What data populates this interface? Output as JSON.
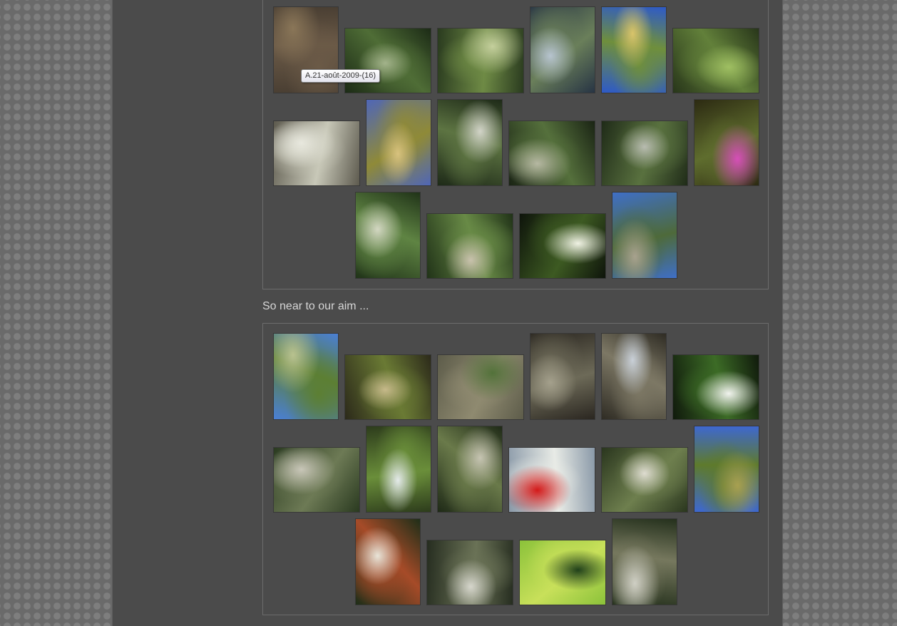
{
  "tooltip": "A.21-août-2009-(16)",
  "caption": "So near to our aim ...",
  "galleries": [
    {
      "id": "gallery-1",
      "photos": [
        {
          "kind": "forest-floor",
          "colors": [
            "#4a3f33",
            "#6b5a47",
            "#8a7658"
          ]
        },
        {
          "kind": "forest-path",
          "colors": [
            "#1c2b16",
            "#4f6d36",
            "#a3b38b"
          ]
        },
        {
          "kind": "hiker-forest",
          "colors": [
            "#2a3b1f",
            "#6e8a45",
            "#c4cf9c"
          ]
        },
        {
          "kind": "stream-rock",
          "colors": [
            "#273444",
            "#6a7f5a",
            "#b7c4cf"
          ]
        },
        {
          "kind": "mountain-sky",
          "colors": [
            "#2e5ac8",
            "#6f8f3c",
            "#d9c46a"
          ]
        },
        {
          "kind": "grass",
          "colors": [
            "#28361a",
            "#62803a",
            "#9fbf62"
          ]
        },
        {
          "kind": "map-sign",
          "colors": [
            "#5d5a4e",
            "#c8c8b8",
            "#e8e8de"
          ]
        },
        {
          "kind": "valley-path",
          "colors": [
            "#4f66b7",
            "#8f8a38",
            "#d8c27e"
          ]
        },
        {
          "kind": "shadow-path",
          "colors": [
            "#1e2a18",
            "#5d7442",
            "#d2d4c8"
          ]
        },
        {
          "kind": "forest-trail",
          "colors": [
            "#1a2414",
            "#55703c",
            "#b6b8a2"
          ]
        },
        {
          "kind": "group-hikers",
          "colors": [
            "#1f2b18",
            "#59713f",
            "#b8bcb0"
          ]
        },
        {
          "kind": "pink-thistle",
          "colors": [
            "#2c2a12",
            "#5f6d2e",
            "#d64fb8"
          ]
        },
        {
          "kind": "resting-hiker",
          "colors": [
            "#203318",
            "#5f8443",
            "#d3d7c2"
          ]
        },
        {
          "kind": "hiker-bench",
          "colors": [
            "#213318",
            "#688a46",
            "#c9c2ad"
          ]
        },
        {
          "kind": "white-flower",
          "colors": [
            "#0e140b",
            "#3d5a22",
            "#f0f2e4"
          ]
        },
        {
          "kind": "mountain-valley",
          "colors": [
            "#3f6fc7",
            "#4e6a3a",
            "#a8a28e"
          ]
        }
      ]
    },
    {
      "id": "gallery-2",
      "photos": [
        {
          "kind": "hiker-slope",
          "colors": [
            "#4a7fd6",
            "#5c7f33",
            "#b9c28f"
          ]
        },
        {
          "kind": "gorge-hiker",
          "colors": [
            "#2c2a1a",
            "#6a7a34",
            "#c6b98a"
          ]
        },
        {
          "kind": "rock-slope",
          "colors": [
            "#5d5c4a",
            "#8f8a70",
            "#53723a"
          ]
        },
        {
          "kind": "fence-path",
          "colors": [
            "#2a2620",
            "#6d6a58",
            "#a4a08c"
          ]
        },
        {
          "kind": "waterfall-rock",
          "colors": [
            "#2f2c24",
            "#7d7865",
            "#c9d0d8"
          ]
        },
        {
          "kind": "white-flowers",
          "colors": [
            "#101a0c",
            "#3c6b26",
            "#f1f3ee"
          ]
        },
        {
          "kind": "river-bridge",
          "colors": [
            "#2a3a20",
            "#6d7a55",
            "#c8c6b8"
          ]
        },
        {
          "kind": "waterfall",
          "colors": [
            "#2d3c1c",
            "#6a8e3a",
            "#e4eaea"
          ]
        },
        {
          "kind": "forest-rocks",
          "colors": [
            "#1f2a17",
            "#6a7a4a",
            "#c6c4b2"
          ]
        },
        {
          "kind": "map-detail",
          "colors": [
            "#8a99a8",
            "#e8ebe6",
            "#d41a1a"
          ]
        },
        {
          "kind": "bridge-group",
          "colors": [
            "#2a361e",
            "#6e7f4e",
            "#dedcd0"
          ]
        },
        {
          "kind": "cliff-sky",
          "colors": [
            "#3e68cf",
            "#5e7a2c",
            "#a8a050"
          ]
        },
        {
          "kind": "signpost",
          "colors": [
            "#1e2e18",
            "#a64b28",
            "#e8e4d8"
          ]
        },
        {
          "kind": "hikers-back",
          "colors": [
            "#262d20",
            "#6a7256",
            "#d6d6cc"
          ]
        },
        {
          "kind": "park-sign",
          "colors": [
            "#8bc23a",
            "#c8e05a",
            "#20401a"
          ]
        },
        {
          "kind": "rocky-stream",
          "colors": [
            "#24301c",
            "#76785e",
            "#cfcfc4"
          ]
        }
      ]
    }
  ]
}
